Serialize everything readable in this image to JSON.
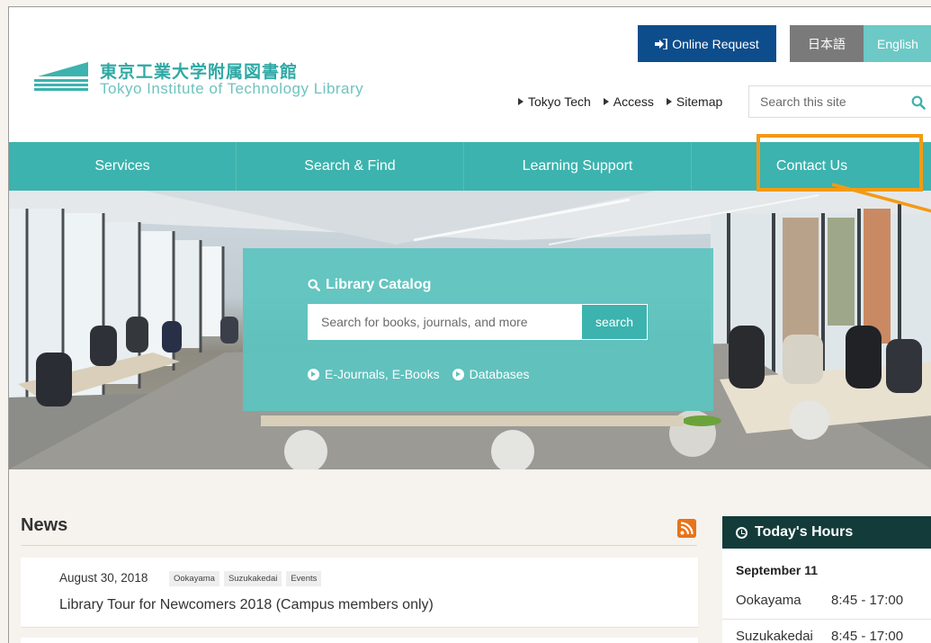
{
  "header": {
    "logo_jp": "東京工業大学附属図書館",
    "logo_en": "Tokyo Institute of Technology Library",
    "online_request_label": "Online Request",
    "lang_japanese_label": "日本語",
    "lang_english_label": "English",
    "utility_links": [
      "Tokyo Tech",
      "Access",
      "Sitemap"
    ],
    "search_placeholder": "Search this site"
  },
  "nav": {
    "items": [
      "Services",
      "Search & Find",
      "Learning Support",
      "Contact Us"
    ],
    "highlight_color": "#f39a14"
  },
  "catalog": {
    "title": "Library Catalog",
    "placeholder": "Search for books, journals, and more",
    "button_label": "search",
    "links": [
      "E-Journals, E-Books",
      "Databases"
    ]
  },
  "news": {
    "title": "News",
    "items": [
      {
        "date": "August 30, 2018",
        "tags": [
          "Ookayama",
          "Suzukakedai",
          "Events"
        ],
        "headline": "Library Tour for Newcomers 2018 (Campus members only)"
      }
    ]
  },
  "hours": {
    "title": "Today's Hours",
    "date": "September 11",
    "rows": [
      {
        "campus": "Ookayama",
        "time": "8:45 - 17:00"
      },
      {
        "campus": "Suzukakedai",
        "time": "8:45 - 17:00"
      }
    ]
  },
  "colors": {
    "teal": "#3cb3ae",
    "navy_button": "#0d4d8c",
    "hours_header": "#133b3a"
  }
}
